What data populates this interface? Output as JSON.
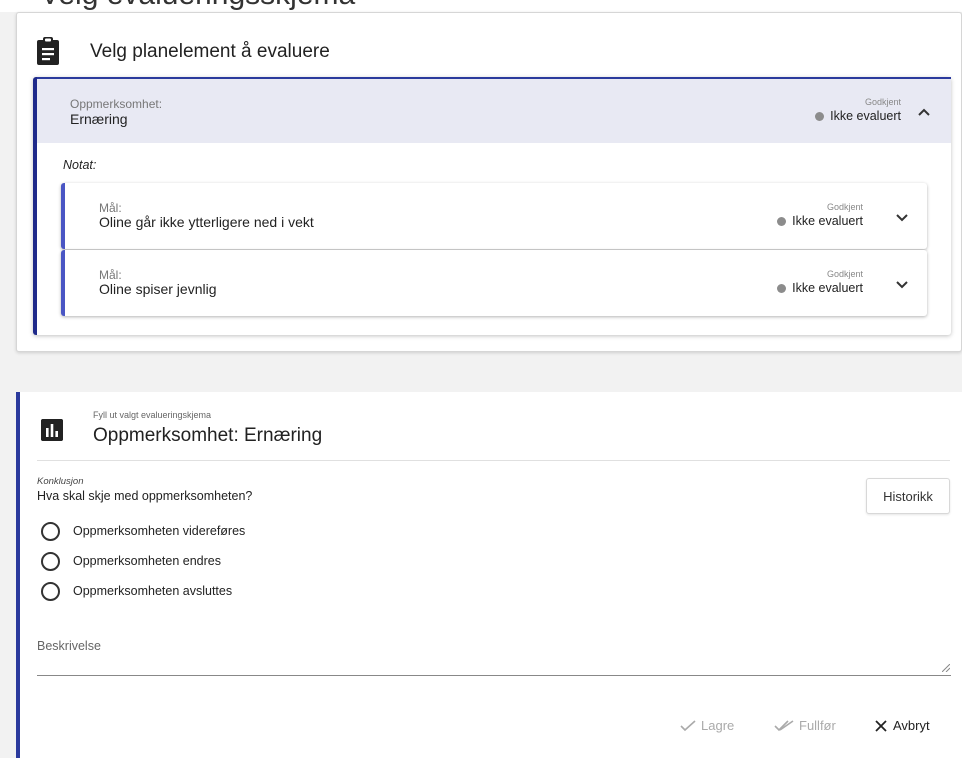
{
  "top": {
    "partial_heading": "Velg evalueringsskjema"
  },
  "plan_card": {
    "title": "Velg planelement å evaluere",
    "element": {
      "type_label": "Oppmerksomhet:",
      "name": "Ernæring",
      "status_caption": "Godkjent",
      "status": "Ikke evaluert",
      "note_label": "Notat:"
    },
    "goals": [
      {
        "type_label": "Mål:",
        "name": "Oline går ikke ytterligere ned i vekt",
        "status_caption": "Godkjent",
        "status": "Ikke evaluert"
      },
      {
        "type_label": "Mål:",
        "name": "Oline spiser jevnlig",
        "status_caption": "Godkjent",
        "status": "Ikke evaluert"
      }
    ]
  },
  "form_card": {
    "subtitle": "Fyll ut valgt evalueringskjema",
    "title": "Oppmerksomhet: Ernæring",
    "conclusion_label": "Konklusjon",
    "question": "Hva skal skje med oppmerksomheten?",
    "history_button": "Historikk",
    "options": [
      "Oppmerksomheten videreføres",
      "Oppmerksomheten endres",
      "Oppmerksomheten avsluttes"
    ],
    "description_label": "Beskrivelse",
    "description_value": "",
    "actions": {
      "save": "Lagre",
      "complete": "Fullfør",
      "cancel": "Avbryt"
    }
  },
  "colors": {
    "accent": "#2b3a9d",
    "goal_accent": "#4a56c4",
    "selected_bg": "#e8e9f3",
    "status_dot": "#8c8c8c"
  },
  "icons": [
    "clipboard-icon",
    "chart-icon",
    "chevron-up-icon",
    "chevron-down-icon",
    "check-icon",
    "double-check-icon",
    "close-icon",
    "radio-icon",
    "resize-icon",
    "status-dot-icon"
  ]
}
